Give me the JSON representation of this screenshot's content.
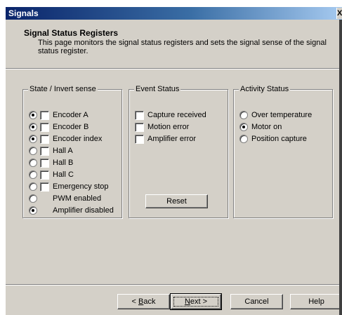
{
  "window": {
    "title": "Signals",
    "close_glyph": "X"
  },
  "header": {
    "title": "Signal Status Registers",
    "description": "This page monitors the signal status registers and sets the signal sense of the signal status register."
  },
  "state_group": {
    "label": "State / Invert sense",
    "items": [
      {
        "label": "Encoder A",
        "radio_on": true,
        "has_checkbox": true
      },
      {
        "label": "Encoder B",
        "radio_on": true,
        "has_checkbox": true
      },
      {
        "label": "Encoder index",
        "radio_on": true,
        "has_checkbox": true
      },
      {
        "label": "Hall A",
        "radio_on": false,
        "has_checkbox": true
      },
      {
        "label": "Hall B",
        "radio_on": false,
        "has_checkbox": true
      },
      {
        "label": "Hall C",
        "radio_on": false,
        "has_checkbox": true
      },
      {
        "label": "Emergency stop",
        "radio_on": false,
        "has_checkbox": true
      },
      {
        "label": "PWM enabled",
        "radio_on": false,
        "has_checkbox": false
      },
      {
        "label": "Amplifier disabled",
        "radio_on": true,
        "has_checkbox": false
      }
    ]
  },
  "event_group": {
    "label": "Event Status",
    "items": [
      {
        "label": "Capture received",
        "checked": false
      },
      {
        "label": "Motion error",
        "checked": false
      },
      {
        "label": "Amplifier error",
        "checked": false
      }
    ],
    "reset_label": "Reset"
  },
  "activity_group": {
    "label": "Activity Status",
    "items": [
      {
        "label": "Over temperature",
        "on": false
      },
      {
        "label": "Motor on",
        "on": true
      },
      {
        "label": "Position capture",
        "on": false
      }
    ]
  },
  "buttons": {
    "back_prefix": "< ",
    "back_mnemonic": "B",
    "back_rest": "ack",
    "next_mnemonic": "N",
    "next_rest": "ext >",
    "cancel": "Cancel",
    "help": "Help"
  }
}
